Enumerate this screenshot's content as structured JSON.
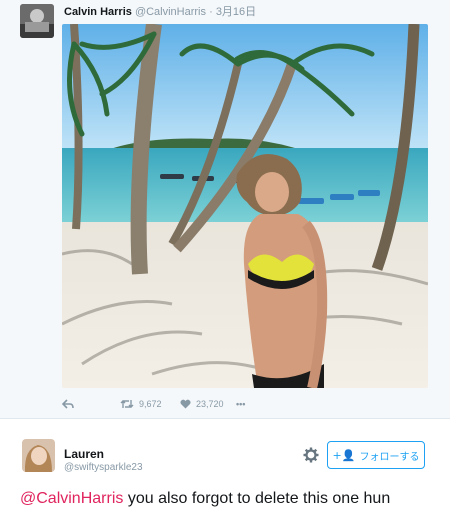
{
  "tweet": {
    "author_name": "Calvin Harris",
    "author_handle": "@CalvinHarris",
    "separator": "·",
    "date": "3月16日",
    "retweets": "9,672",
    "likes": "23,720",
    "more": "•••"
  },
  "reply": {
    "name": "Lauren",
    "handle": "@swiftysparkle23",
    "follow_label": "フォローする",
    "mention": "@CalvinHarris",
    "text": " you also forgot to delete this one hun"
  },
  "colors": {
    "accent": "#1da1f2",
    "mention": "#e0245e",
    "muted": "#8899a6"
  }
}
